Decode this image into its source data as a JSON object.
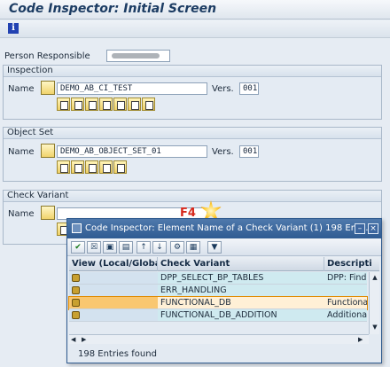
{
  "window": {
    "title": "Code Inspector: Initial Screen"
  },
  "toolbar": {
    "info_icon": "info-icon"
  },
  "person": {
    "label": "Person Responsible"
  },
  "inspection": {
    "group_label": "Inspection",
    "name_label": "Name",
    "name_value": "DEMO_AB_CI_TEST",
    "vers_label": "Vers.",
    "vers_value": "001"
  },
  "object_set": {
    "group_label": "Object Set",
    "name_label": "Name",
    "name_value": "DEMO_AB_OBJECT_SET_01",
    "vers_label": "Vers.",
    "vers_value": "001"
  },
  "check_variant": {
    "group_label": "Check Variant",
    "name_label": "Name",
    "name_value": ""
  },
  "hint": {
    "key": "F4"
  },
  "popup": {
    "title": "Code Inspector: Element Name of a Check Variant (1)  198 Ent...",
    "columns": [
      "View (Local/Global)",
      "Check Variant",
      "Descripti"
    ],
    "rows": [
      {
        "variant": "DPP_SELECT_BP_TABLES",
        "description": "DPP: Find",
        "selected": false
      },
      {
        "variant": "ERR_HANDLING",
        "description": "",
        "selected": false
      },
      {
        "variant": "FUNCTIONAL_DB",
        "description": "Functiona",
        "selected": true
      },
      {
        "variant": "FUNCTIONAL_DB_ADDITION",
        "description": "Additional",
        "selected": false
      }
    ],
    "status": "198 Entries found"
  },
  "colors": {
    "accent": "#2f5b92",
    "title_text": "#1c3c63",
    "selection": "#f9c770"
  }
}
